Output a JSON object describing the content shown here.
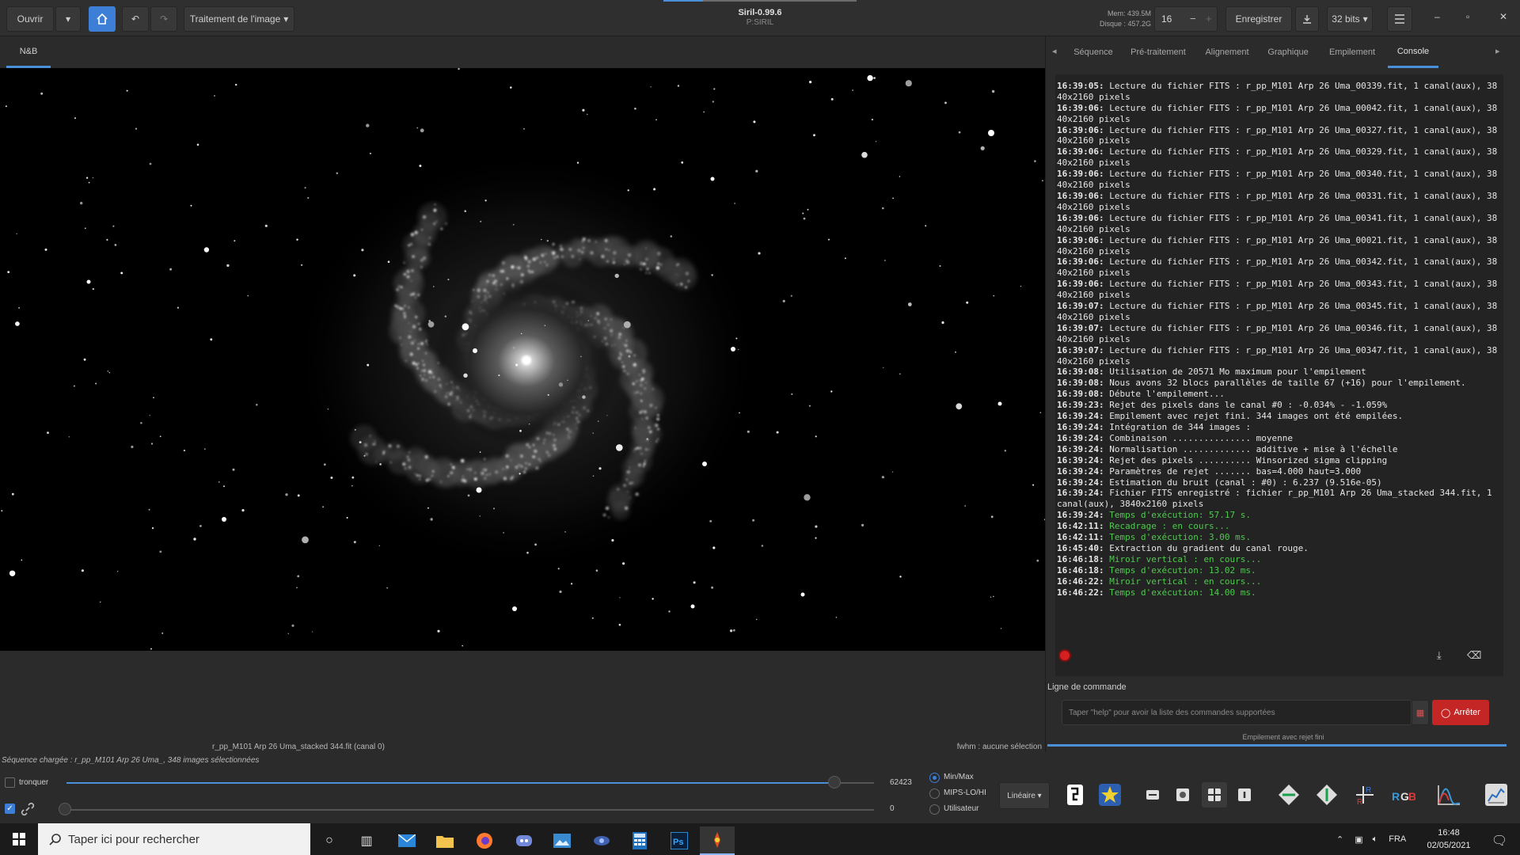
{
  "header": {
    "open_label": "Ouvrir",
    "image_processing_menu": "Traitement de l'image",
    "app_title": "Siril-0.99.6",
    "project_title": "P:SIRIL",
    "mem": "Mem: 439.5M",
    "disk": "Disque : 457.2G",
    "threads_value": "16",
    "save_label": "Enregistrer",
    "bits_label": "32 bits",
    "minimize": "–",
    "maximize": "▫",
    "close": "✕"
  },
  "image_tabs": [
    {
      "label": "N&B"
    }
  ],
  "right_tabs": [
    {
      "label": "Séquence"
    },
    {
      "label": "Pré-traitement"
    },
    {
      "label": "Alignement"
    },
    {
      "label": "Graphique"
    },
    {
      "label": "Empilement"
    },
    {
      "label": "Console"
    }
  ],
  "console": {
    "lines": [
      {
        "ts": "16:39:05:",
        "text": " Lecture du fichier FITS : r_pp_M101 Arp 26 Uma_00339.fit, 1 canal(aux), 3840x2160 pixels",
        "green": false
      },
      {
        "ts": "16:39:06:",
        "text": " Lecture du fichier FITS : r_pp_M101 Arp 26 Uma_00042.fit, 1 canal(aux), 3840x2160 pixels",
        "green": false
      },
      {
        "ts": "16:39:06:",
        "text": " Lecture du fichier FITS : r_pp_M101 Arp 26 Uma_00327.fit, 1 canal(aux), 3840x2160 pixels",
        "green": false
      },
      {
        "ts": "16:39:06:",
        "text": " Lecture du fichier FITS : r_pp_M101 Arp 26 Uma_00329.fit, 1 canal(aux), 3840x2160 pixels",
        "green": false
      },
      {
        "ts": "16:39:06:",
        "text": " Lecture du fichier FITS : r_pp_M101 Arp 26 Uma_00340.fit, 1 canal(aux), 3840x2160 pixels",
        "green": false
      },
      {
        "ts": "16:39:06:",
        "text": " Lecture du fichier FITS : r_pp_M101 Arp 26 Uma_00331.fit, 1 canal(aux), 3840x2160 pixels",
        "green": false
      },
      {
        "ts": "16:39:06:",
        "text": " Lecture du fichier FITS : r_pp_M101 Arp 26 Uma_00341.fit, 1 canal(aux), 3840x2160 pixels",
        "green": false
      },
      {
        "ts": "16:39:06:",
        "text": " Lecture du fichier FITS : r_pp_M101 Arp 26 Uma_00021.fit, 1 canal(aux), 3840x2160 pixels",
        "green": false
      },
      {
        "ts": "16:39:06:",
        "text": " Lecture du fichier FITS : r_pp_M101 Arp 26 Uma_00342.fit, 1 canal(aux), 3840x2160 pixels",
        "green": false
      },
      {
        "ts": "16:39:06:",
        "text": " Lecture du fichier FITS : r_pp_M101 Arp 26 Uma_00343.fit, 1 canal(aux), 3840x2160 pixels",
        "green": false
      },
      {
        "ts": "16:39:07:",
        "text": " Lecture du fichier FITS : r_pp_M101 Arp 26 Uma_00345.fit, 1 canal(aux), 3840x2160 pixels",
        "green": false
      },
      {
        "ts": "16:39:07:",
        "text": " Lecture du fichier FITS : r_pp_M101 Arp 26 Uma_00346.fit, 1 canal(aux), 3840x2160 pixels",
        "green": false
      },
      {
        "ts": "16:39:07:",
        "text": " Lecture du fichier FITS : r_pp_M101 Arp 26 Uma_00347.fit, 1 canal(aux), 3840x2160 pixels",
        "green": false
      },
      {
        "ts": "16:39:08:",
        "text": " Utilisation de 20571 Mo maximum pour l'empilement",
        "green": false
      },
      {
        "ts": "16:39:08:",
        "text": " Nous avons 32 blocs parallèles de taille 67 (+16) pour l'empilement.",
        "green": false
      },
      {
        "ts": "16:39:08:",
        "text": " Débute l'empilement...",
        "green": false
      },
      {
        "ts": "16:39:23:",
        "text": " Rejet des pixels dans le canal #0 : -0.034% - -1.059%",
        "green": false
      },
      {
        "ts": "16:39:24:",
        "text": " Empilement avec rejet fini. 344 images ont été empilées.",
        "green": false
      },
      {
        "ts": "16:39:24:",
        "text": " Intégration de 344 images :",
        "green": false
      },
      {
        "ts": "16:39:24:",
        "text": " Combinaison ............... moyenne",
        "green": false
      },
      {
        "ts": "16:39:24:",
        "text": " Normalisation ............. additive + mise à l'échelle",
        "green": false
      },
      {
        "ts": "16:39:24:",
        "text": " Rejet des pixels .......... Winsorized sigma clipping",
        "green": false
      },
      {
        "ts": "16:39:24:",
        "text": " Paramètres de rejet ....... bas=4.000 haut=3.000",
        "green": false
      },
      {
        "ts": "16:39:24:",
        "text": " Estimation du bruit (canal : #0) : 6.237 (9.516e-05)",
        "green": false
      },
      {
        "ts": "16:39:24:",
        "text": " Fichier FITS enregistré : fichier r_pp_M101 Arp 26 Uma_stacked 344.fit, 1 canal(aux), 3840x2160 pixels",
        "green": false
      },
      {
        "ts": "16:39:24:",
        "text": " Temps d'exécution: 57.17 s.",
        "green": true
      },
      {
        "ts": "16:42:11:",
        "text": " Recadrage : en cours...",
        "green": true
      },
      {
        "ts": "16:42:11:",
        "text": " Temps d'exécution: 3.00 ms.",
        "green": true
      },
      {
        "ts": "16:45:40:",
        "text": " Extraction du gradient du canal rouge.",
        "green": false
      },
      {
        "ts": "16:46:18:",
        "text": " Miroir vertical : en cours...",
        "green": true
      },
      {
        "ts": "16:46:18:",
        "text": " Temps d'exécution: 13.02 ms.",
        "green": true
      },
      {
        "ts": "16:46:22:",
        "text": " Miroir vertical : en cours...",
        "green": true
      },
      {
        "ts": "16:46:22:",
        "text": " Temps d'exécution: 14.00 ms.",
        "green": true
      }
    ]
  },
  "command": {
    "label": "Ligne de commande",
    "placeholder": "Taper \"help\" pour avoir la liste des commandes supportées",
    "stop_label": "Arrêter",
    "progress_text": "Empilement avec rejet fini"
  },
  "image_info": {
    "filename": "r_pp_M101 Arp 26 Uma_stacked 344.fit (canal 0)",
    "fwhm": "fwhm : aucune sélection"
  },
  "status": {
    "sequence": "Séquence chargée : r_pp_M101 Arp 26 Uma_, 348 images sélectionnées"
  },
  "display": {
    "clip_label": "tronquer",
    "high_value": "62423",
    "low_value": "0",
    "mode_options": [
      "Min/Max",
      "MIPS-LO/HI",
      "Utilisateur"
    ],
    "selected_mode": "Min/Max",
    "stretch_label": "Linéaire"
  },
  "taskbar": {
    "search_placeholder": "Taper ici pour rechercher",
    "lang": "FRA",
    "time": "16:48",
    "date": "02/05/2021"
  }
}
